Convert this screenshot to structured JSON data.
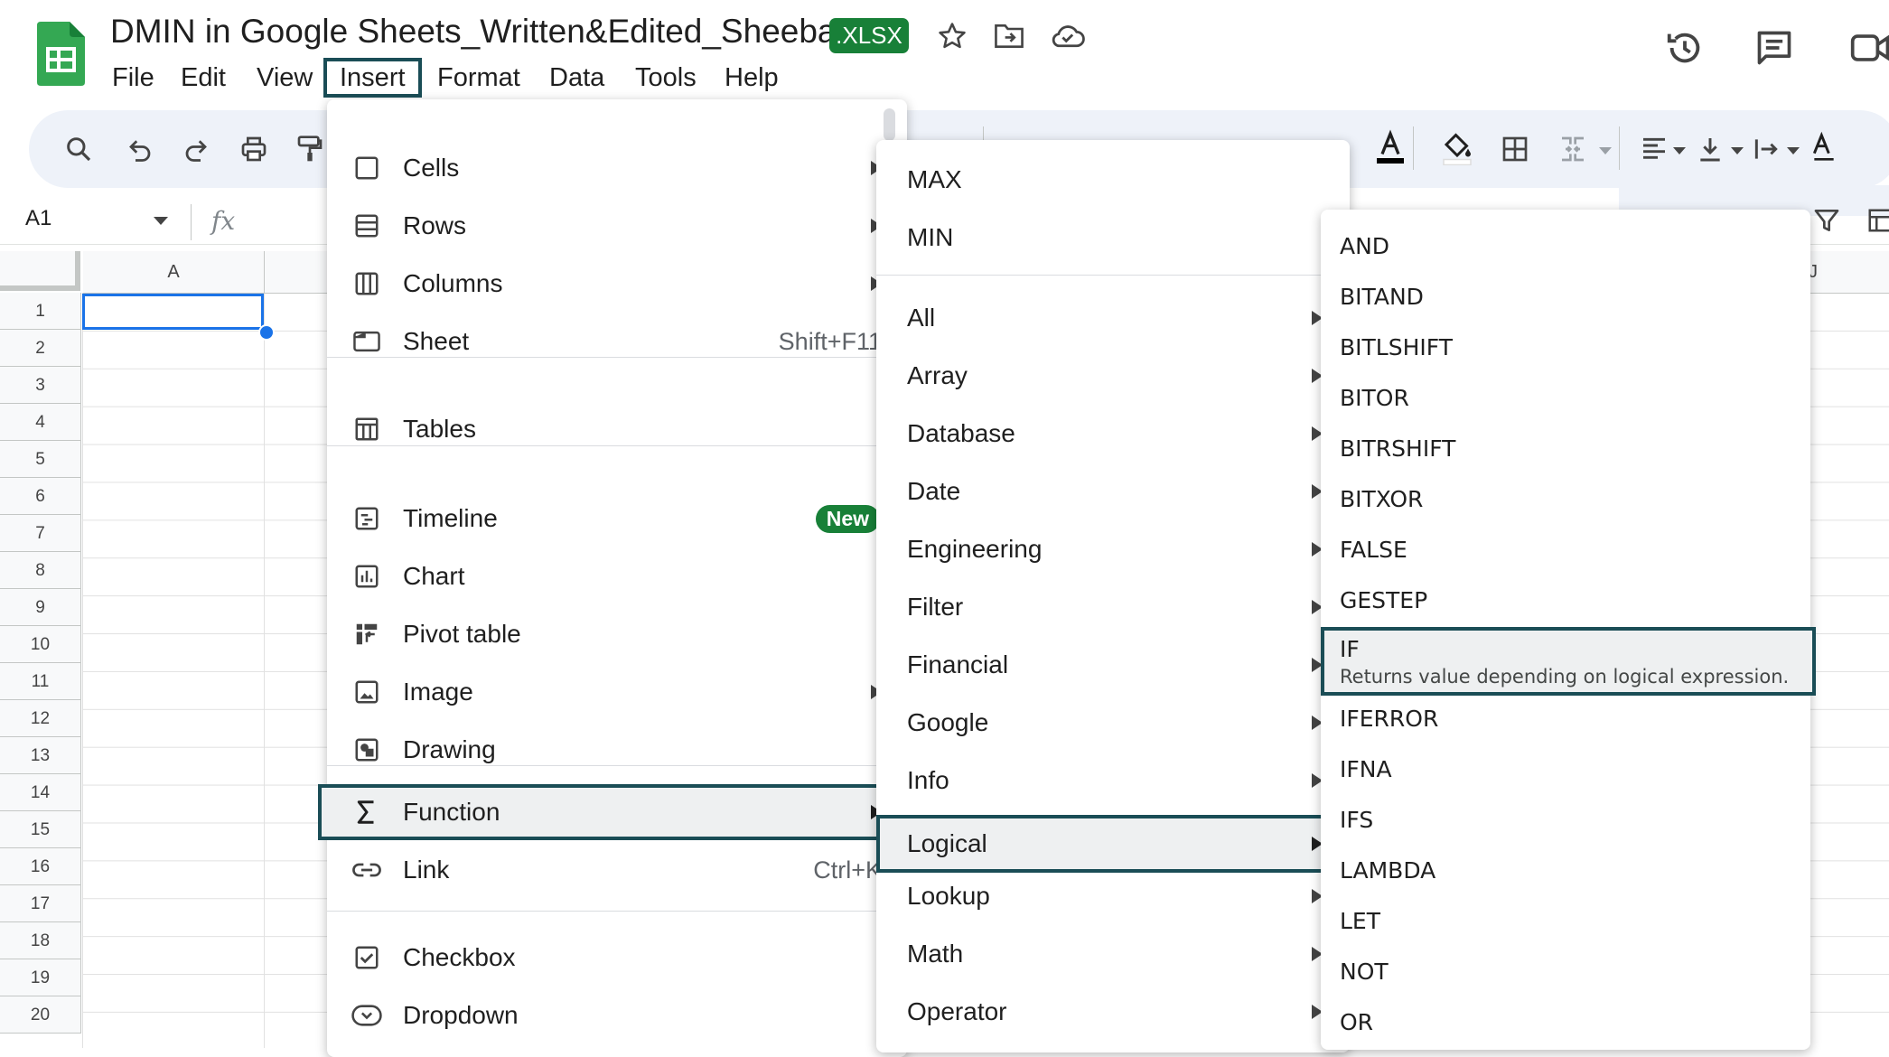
{
  "header": {
    "doc_title": "DMIN in Google Sheets_Written&Edited_Sheeba",
    "file_badge": ".XLSX"
  },
  "menubar": [
    "File",
    "Edit",
    "View",
    "Insert",
    "Format",
    "Data",
    "Tools",
    "Help"
  ],
  "menubar_active": "Insert",
  "formula_bar": {
    "name_box": "A1",
    "fx": "fx"
  },
  "grid": {
    "column_a": "A",
    "column_j": "J",
    "rows": [
      "1",
      "2",
      "3",
      "4",
      "5",
      "6",
      "7",
      "8",
      "9",
      "10",
      "11",
      "12",
      "13",
      "14",
      "15",
      "16",
      "17",
      "18",
      "19",
      "20"
    ],
    "selected_cell": "A1"
  },
  "insert_menu": {
    "cells": "Cells",
    "rows": "Rows",
    "columns": "Columns",
    "sheet": "Sheet",
    "sheet_shortcut": "Shift+F11",
    "tables": "Tables",
    "timeline": "Timeline",
    "timeline_badge": "New",
    "chart": "Chart",
    "pivot_table": "Pivot table",
    "image": "Image",
    "drawing": "Drawing",
    "function": "Function",
    "link": "Link",
    "link_shortcut": "Ctrl+K",
    "checkbox": "Checkbox",
    "dropdown": "Dropdown"
  },
  "function_menu": {
    "quick": [
      "MAX",
      "MIN"
    ],
    "categories": [
      "All",
      "Array",
      "Database",
      "Date",
      "Engineering",
      "Filter",
      "Financial",
      "Google",
      "Info",
      "Logical",
      "Lookup",
      "Math",
      "Operator"
    ],
    "highlighted": "Logical"
  },
  "logical_menu": {
    "items_before": [
      "AND",
      "BITAND",
      "BITLSHIFT",
      "BITOR",
      "BITRSHIFT",
      "BITXOR",
      "FALSE",
      "GESTEP"
    ],
    "highlighted": {
      "name": "IF",
      "description": "Returns value depending on logical expression."
    },
    "items_after": [
      "IFERROR",
      "IFNA",
      "IFS",
      "LAMBDA",
      "LET",
      "NOT",
      "OR"
    ]
  },
  "colors": {
    "accent_outline": "#1a4d56",
    "brand_green": "#188038",
    "selection_blue": "#1a73e8",
    "toolbar_bg": "#eef2f9"
  }
}
